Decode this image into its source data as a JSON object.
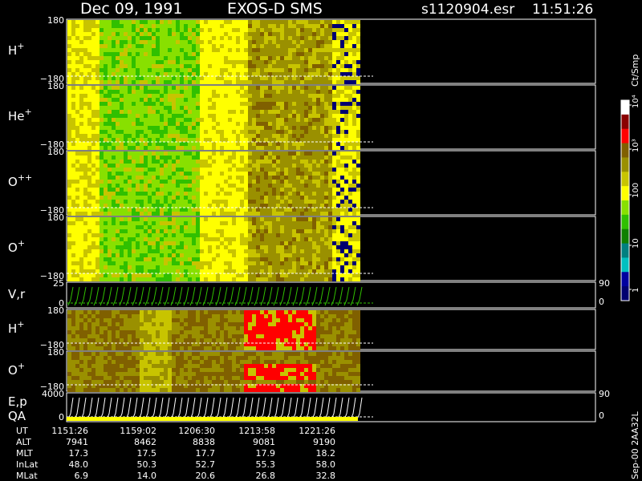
{
  "header": {
    "date": "Dec 09, 1991",
    "instrument": "EXOS-D SMS",
    "file": "s1120904.esr",
    "time": "11:51:26"
  },
  "colorbar": {
    "unit": "Ct/Smp",
    "tick_labels": [
      "10⁴",
      "10³",
      "100",
      "10",
      "1"
    ],
    "colors": [
      "#ffffff",
      "#8a0000",
      "#ff0000",
      "#806000",
      "#9a9000",
      "#c8c400",
      "#ffff00",
      "#88e000",
      "#30c000",
      "#108000",
      "#008080",
      "#00c0c0",
      "#0000a0",
      "#000070"
    ]
  },
  "side_note": "Sep-00 2AA32L",
  "panels": [
    {
      "label": "H",
      "sup": "+",
      "ytop": "180",
      "ybot": "−180"
    },
    {
      "label": "He",
      "sup": "+",
      "ytop": "180",
      "ybot": "−180"
    },
    {
      "label": "O",
      "sup": "++",
      "ytop": "180",
      "ybot": "−180"
    },
    {
      "label": "O",
      "sup": "+",
      "ytop": "180",
      "ybot": "−180"
    },
    {
      "label": "V,r",
      "sup": "",
      "ytop": "25",
      "ybot": "0",
      "rtop": "90",
      "rbot": "0"
    },
    {
      "label": "H",
      "sup": "+",
      "ytop": "180",
      "ybot": "−180"
    },
    {
      "label": "O",
      "sup": "+",
      "ytop": "180",
      "ybot": "−180"
    },
    {
      "label": "E,p",
      "sup": "",
      "label2": "QA",
      "ytop": "4000",
      "ybot": "0",
      "rtop": "90",
      "rbot": "0"
    }
  ],
  "ephemeris": {
    "rows": [
      {
        "name": "UT",
        "values": [
          "1151:26",
          "1159:02",
          "1206:30",
          "1213:58",
          "1221:26"
        ]
      },
      {
        "name": "ALT",
        "values": [
          "7941",
          "8462",
          "8838",
          "9081",
          "9190"
        ]
      },
      {
        "name": "MLT",
        "values": [
          "17.3",
          "17.5",
          "17.7",
          "17.9",
          "18.2"
        ]
      },
      {
        "name": "InLat",
        "values": [
          "48.0",
          "50.3",
          "52.7",
          "55.3",
          "58.0"
        ]
      },
      {
        "name": "MLat",
        "values": [
          "6.9",
          "14.0",
          "20.6",
          "26.8",
          "32.8"
        ]
      }
    ]
  },
  "chart_data": {
    "type": "heatmap",
    "title": "Dec 09, 1991   EXOS-D SMS",
    "xlabel": "UT",
    "x_ticks": [
      "1151:26",
      "1159:02",
      "1206:30",
      "1213:58",
      "1221:26"
    ],
    "color_scale": "log",
    "color_range": [
      1,
      10000
    ],
    "color_unit": "Ct/Smp",
    "panels": [
      {
        "species": "H+",
        "ylim": [
          -180,
          180
        ],
        "count_level_by_segment": [
          100,
          30,
          20,
          60,
          300,
          600,
          250,
          40
        ]
      },
      {
        "species": "He+",
        "ylim": [
          -180,
          180
        ],
        "count_level_by_segment": [
          100,
          30,
          20,
          60,
          300,
          600,
          250,
          40
        ]
      },
      {
        "species": "O++",
        "ylim": [
          -180,
          180
        ],
        "count_level_by_segment": [
          100,
          30,
          20,
          60,
          300,
          600,
          250,
          40
        ]
      },
      {
        "species": "O+",
        "ylim": [
          -180,
          180
        ],
        "count_level_by_segment": [
          100,
          30,
          20,
          60,
          300,
          600,
          250,
          40
        ]
      },
      {
        "species": "V,r",
        "ylim": [
          0,
          25
        ],
        "right_axis": [
          0,
          90
        ],
        "type": "line"
      },
      {
        "species": "H+",
        "ylim": [
          -180,
          180
        ],
        "count_level_by_segment": [
          400,
          150,
          400,
          300,
          2000,
          1500,
          600
        ]
      },
      {
        "species": "O+",
        "ylim": [
          -180,
          180
        ],
        "count_level_by_segment": [
          500,
          200,
          300,
          400,
          2000,
          800,
          400
        ]
      },
      {
        "species": "E,p / QA",
        "ylim": [
          0,
          4000
        ],
        "right_axis": [
          0,
          90
        ],
        "type": "line"
      }
    ]
  }
}
